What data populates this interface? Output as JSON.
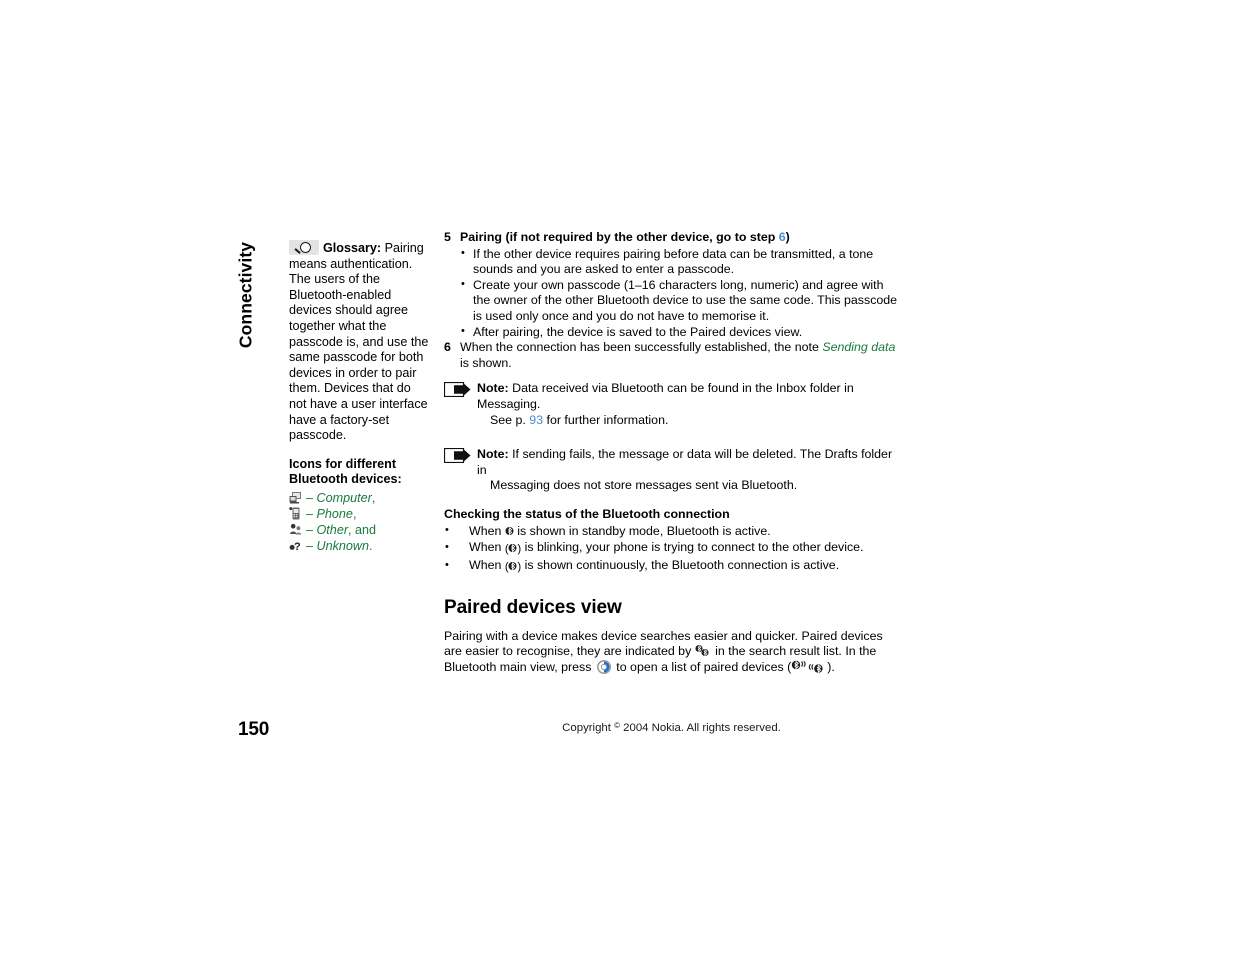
{
  "chapter_tab": {
    "label": "Connectivity"
  },
  "sidebar": {
    "glossary_icon_name": "magnifier-icon",
    "glossary_label": "Glossary:",
    "glossary_text": " Pairing means authentication. The users of the Bluetooth-enabled devices should agree together what the passcode is, and use the same passcode for both devices in order to pair them. Devices that do not have a user interface have a factory-set passcode.",
    "icons_heading_line1": "Icons for different",
    "icons_heading_line2": "Bluetooth devices:",
    "device_items": [
      {
        "icon": "computer-icon",
        "dash": "–",
        "term": "Computer",
        "tail": ","
      },
      {
        "icon": "phone-icon",
        "dash": "–",
        "term": "Phone",
        "tail": ","
      },
      {
        "icon": "other-device-icon",
        "dash": "–",
        "term": "Other",
        "tail": ", and"
      },
      {
        "icon": "unknown-device-icon",
        "dash": "–",
        "term": "Unknown",
        "tail": "."
      }
    ]
  },
  "main": {
    "step5": {
      "number": "5",
      "title_before": "Pairing (if not required by the other device, go to step ",
      "title_link": "6",
      "title_after": ")",
      "bullets": [
        "If the other device requires pairing before data can be transmitted, a tone sounds and you are asked to enter a passcode.",
        "Create your own passcode (1–16 characters long, numeric) and agree with the owner of the other Bluetooth device to use the same code. This passcode is used only once and you do not have to memorise it.",
        "After pairing, the device is saved to the Paired devices view."
      ]
    },
    "step6": {
      "number": "6",
      "text_before": "When the connection has been successfully established, the note ",
      "note_name": "Sending data",
      "text_after": " is shown."
    },
    "note1": {
      "icon_name": "note-arrow-icon",
      "label": "Note:",
      "text_line1": " Data received via Bluetooth can be found in the Inbox folder in Messaging.",
      "text_line2_before": "See p. ",
      "text_line2_link": "93",
      "text_line2_after": " for further information."
    },
    "note2": {
      "icon_name": "note-arrow-icon",
      "label": "Note:",
      "text_line1": " If sending fails, the message or data will be deleted. The Drafts folder in",
      "text_line2": "Messaging does not store messages sent via Bluetooth."
    },
    "status_section": {
      "heading": "Checking the status of the Bluetooth connection",
      "items": [
        {
          "before": "When ",
          "icon": "bluetooth-icon",
          "after": " is shown in standby mode, Bluetooth is active."
        },
        {
          "before": "When ",
          "icon": "bluetooth-connecting-icon",
          "after": " is blinking, your phone is trying to connect to the other device."
        },
        {
          "before": "When ",
          "icon": "bluetooth-connected-icon",
          "after": " is shown continuously, the Bluetooth connection is active."
        }
      ]
    },
    "paired_section": {
      "heading": "Paired devices view",
      "para_part1": "Pairing with a device makes device searches easier and quicker. Paired devices are easier to recognise, they are indicated by ",
      "paired_icon": "paired-devices-icon",
      "para_part2": " in the search result list. In the Bluetooth main view, press ",
      "navkey_icon": "navigation-key-icon",
      "para_part3": " to open a list of paired devices (",
      "connect_icon": "bluetooth-connection-icon",
      "para_part4": ")."
    }
  },
  "footer": {
    "page_number": "150",
    "copyright_before": "Copyright ",
    "copyright_symbol": "©",
    "copyright_after": " 2004 Nokia. All rights reserved."
  },
  "colors": {
    "link": "#4a8fd4",
    "term_green": "#1a7a3c",
    "navkey_blue": "#1a6fd4",
    "text": "#000000"
  }
}
